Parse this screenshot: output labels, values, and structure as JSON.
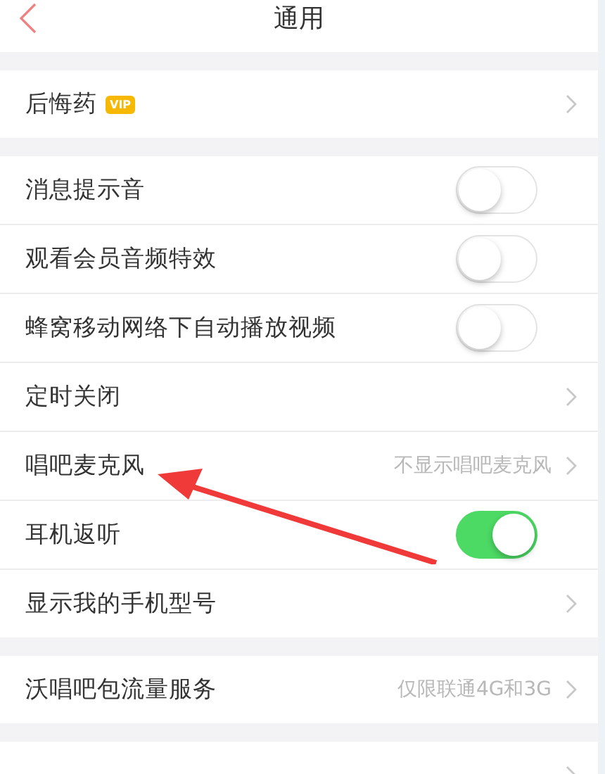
{
  "header": {
    "title": "通用"
  },
  "groups": [
    {
      "rows": [
        {
          "kind": "link",
          "label": "后悔药",
          "badge": "VIP"
        }
      ]
    },
    {
      "rows": [
        {
          "kind": "toggle",
          "label": "消息提示音",
          "on": false
        },
        {
          "kind": "toggle",
          "label": "观看会员音频特效",
          "on": false
        },
        {
          "kind": "toggle",
          "label": "蜂窝移动网络下自动播放视频",
          "on": false
        },
        {
          "kind": "link",
          "label": "定时关闭"
        },
        {
          "kind": "link",
          "label": "唱吧麦克风",
          "value": "不显示唱吧麦克风"
        },
        {
          "kind": "toggle",
          "label": "耳机返听",
          "on": true
        },
        {
          "kind": "link",
          "label": "显示我的手机型号"
        }
      ]
    },
    {
      "rows": [
        {
          "kind": "link",
          "label": "沃唱吧包流量服务",
          "value": "仅限联通4G和3G"
        }
      ]
    },
    {
      "rows": [
        {
          "kind": "link"
        }
      ]
    }
  ]
}
